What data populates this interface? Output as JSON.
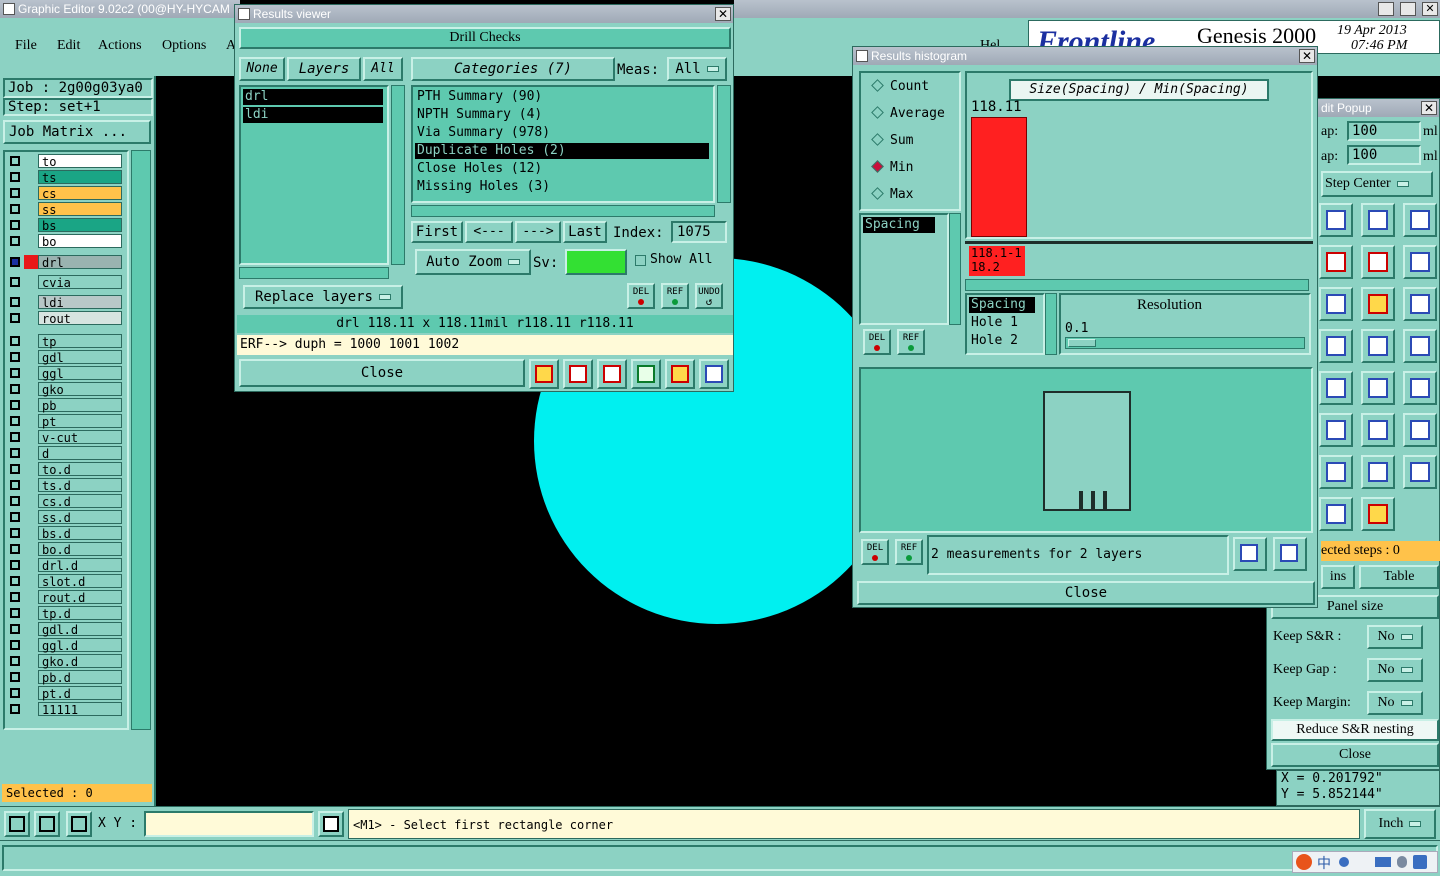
{
  "app": {
    "title": "Graphic Editor 9.02c2 (00@HY-HYCAM",
    "menu": [
      "File",
      "Edit",
      "Actions",
      "Options",
      "A"
    ],
    "help": "Hel",
    "brand": "Frontline",
    "product": "Genesis 2000",
    "date": "19 Apr 2013",
    "time": "07:46 PM"
  },
  "job": {
    "job_label": "Job : 2g00g03ya0",
    "step_label": "Step: set+1",
    "matrix_button": "Job Matrix ...",
    "selected": "Selected : 0"
  },
  "layers": [
    {
      "name": "to",
      "color": "#ffffff"
    },
    {
      "name": "ts",
      "color": "#1aa585"
    },
    {
      "name": "cs",
      "color": "#ffc24a"
    },
    {
      "name": "ss",
      "color": "#ffc24a"
    },
    {
      "name": "bs",
      "color": "#1aa585"
    },
    {
      "name": "bo",
      "color": "#ffffff"
    },
    {
      "name": "drl",
      "color": "#9ab3b0"
    },
    {
      "name": "cvia",
      "color": "#8cd2c3"
    },
    {
      "name": "ldi",
      "color": "#b8c8c8"
    },
    {
      "name": "rout",
      "color": "#d6e4e0"
    },
    {
      "name": "tp",
      "color": "#8cd2c3"
    },
    {
      "name": "gdl",
      "color": "#8cd2c3"
    },
    {
      "name": "ggl",
      "color": "#8cd2c3"
    },
    {
      "name": "gko",
      "color": "#8cd2c3"
    },
    {
      "name": "pb",
      "color": "#8cd2c3"
    },
    {
      "name": "pt",
      "color": "#8cd2c3"
    },
    {
      "name": "v-cut",
      "color": "#8cd2c3"
    },
    {
      "name": "d",
      "color": "#8cd2c3"
    },
    {
      "name": "to.d",
      "color": "#8cd2c3"
    },
    {
      "name": "ts.d",
      "color": "#8cd2c3"
    },
    {
      "name": "cs.d",
      "color": "#8cd2c3"
    },
    {
      "name": "ss.d",
      "color": "#8cd2c3"
    },
    {
      "name": "bs.d",
      "color": "#8cd2c3"
    },
    {
      "name": "bo.d",
      "color": "#8cd2c3"
    },
    {
      "name": "drl.d",
      "color": "#8cd2c3"
    },
    {
      "name": "slot.d",
      "color": "#8cd2c3"
    },
    {
      "name": "rout.d",
      "color": "#8cd2c3"
    },
    {
      "name": "tp.d",
      "color": "#8cd2c3"
    },
    {
      "name": "gdl.d",
      "color": "#8cd2c3"
    },
    {
      "name": "ggl.d",
      "color": "#8cd2c3"
    },
    {
      "name": "gko.d",
      "color": "#8cd2c3"
    },
    {
      "name": "pb.d",
      "color": "#8cd2c3"
    },
    {
      "name": "pt.d",
      "color": "#8cd2c3"
    },
    {
      "name": "11111",
      "color": "#8cd2c3"
    }
  ],
  "results_viewer": {
    "title": "Results viewer",
    "header": "Drill Checks",
    "none_btn": "None",
    "layers_btn": "Layers",
    "all_btn": "All",
    "categories_btn": "Categories (7)",
    "meas_label": "Meas:",
    "meas_value": "All",
    "layer_list": [
      "drl",
      "ldi"
    ],
    "categories": [
      "PTH Summary (90)",
      "NPTH Summary (4)",
      "Via Summary (978)",
      "Duplicate Holes (2)",
      "Close Holes (12)",
      "Missing Holes (3)"
    ],
    "selected_category": 3,
    "first": "First",
    "prev": "<---",
    "next": "--->",
    "last": "Last",
    "index_label": "Index:",
    "index_value": "1075",
    "auto_zoom": "Auto Zoom",
    "sv_label": "Sv:",
    "show_all": "Show All",
    "replace_layers": "Replace layers",
    "del": "DEL",
    "ref": "REF",
    "undo": "UNDO",
    "status_line": "drl 118.11 x 118.11mil  r118.11  r118.11",
    "erf_line": "ERF--> duph = 1000 1001 1002",
    "close": "Close"
  },
  "histogram": {
    "title": "Results histogram",
    "modes": [
      "Count",
      "Average",
      "Sum",
      "Min",
      "Max"
    ],
    "selected_mode": 3,
    "list_item": "Spacing",
    "chart_title": "Size(Spacing) / Min(Spacing)",
    "bar_value": "118.11",
    "bar_fraction": 1.0,
    "range_label": "118.1-118.2",
    "table_rows": [
      "Spacing",
      "Hole 1",
      "Hole 2"
    ],
    "resolution_label": "Resolution",
    "resolution_value": "0.1",
    "summary": "2 measurements for 2 layers",
    "del": "DEL",
    "ref": "REF",
    "close": "Close"
  },
  "edit_popup": {
    "title": "dit Popup",
    "gap1_label": "ap:",
    "gap1_value": "100",
    "gap2_label": "ap:",
    "gap2_value": "100",
    "unit": "ml",
    "step_center": "Step Center",
    "selected_steps": "ected steps : 0",
    "ins_btn": "ins",
    "table_btn": "Table",
    "panel_size": "Panel size",
    "keep_sr": "Keep S&R  :",
    "keep_gap": "Keep Gap   :",
    "keep_margin": "Keep Margin:",
    "no": "No",
    "reduce": "Reduce S&R nesting",
    "close": "Close"
  },
  "coords": {
    "x": "X = 0.201792\"",
    "y": "Y = 5.852144\""
  },
  "bottom": {
    "xy_label": "X Y :",
    "xy_value": "",
    "prompt": "<M1> - Select first rectangle corner",
    "units": "Inch",
    "tray_lang": "中"
  },
  "colors": {
    "panel": "#8cd2c3",
    "teal": "#5ec9af",
    "cyan_pad": "#00f0f0",
    "bar": "#ff2020"
  }
}
